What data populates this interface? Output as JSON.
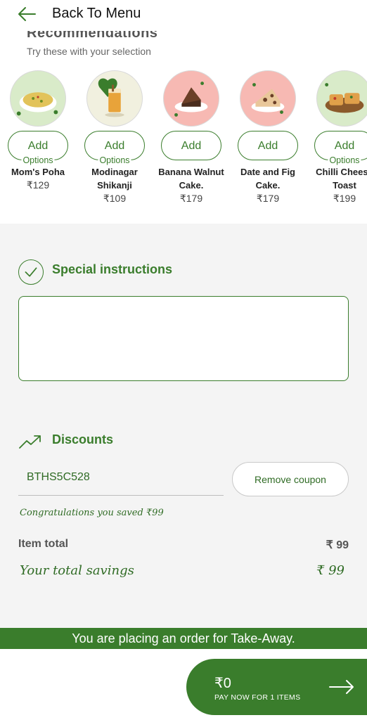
{
  "header": {
    "back_label": "Back To Menu"
  },
  "recommendations": {
    "heading_partial": "Recommendations",
    "subtitle": "Try these with your selection",
    "items": [
      {
        "name_line1": "Mom's Poha",
        "name_line2": "",
        "price": "₹129",
        "add_label": "Add",
        "options_label": "Options",
        "has_options": true,
        "bg": "#d9ebc9"
      },
      {
        "name_line1": "Modinagar",
        "name_line2": "Shikanji",
        "price": "₹109",
        "add_label": "Add",
        "options_label": "Options",
        "has_options": true,
        "bg": "#f1f0df"
      },
      {
        "name_line1": "Banana Walnut",
        "name_line2": "Cake.",
        "price": "₹179",
        "add_label": "Add",
        "options_label": "",
        "has_options": false,
        "bg": "#f7b9b3"
      },
      {
        "name_line1": "Date and Fig",
        "name_line2": "Cake.",
        "price": "₹179",
        "add_label": "Add",
        "options_label": "",
        "has_options": false,
        "bg": "#f7b9b3"
      },
      {
        "name_line1": "Chilli Cheese",
        "name_line2": "Toast",
        "price": "₹199",
        "add_label": "Add",
        "options_label": "Options",
        "has_options": true,
        "bg": "#d9ebc9"
      }
    ]
  },
  "special_instructions": {
    "title": "Special instructions",
    "value": "",
    "placeholder": ""
  },
  "discounts": {
    "title": "Discounts",
    "coupon_code": "BTHS5C528",
    "remove_label": "Remove coupon",
    "congrats": "Congratulations you saved ₹99",
    "item_total_label": "Item total",
    "item_total_value": "₹ 99",
    "savings_label": "Your total savings",
    "savings_value": "₹ 99"
  },
  "order_banner": "You are placing an order for Take-Away.",
  "pay": {
    "amount": "₹0",
    "label": "PAY NOW FOR 1 ITEMS"
  },
  "colors": {
    "brand_green": "#3a7d2c",
    "page_bg": "#f4f4f4"
  }
}
